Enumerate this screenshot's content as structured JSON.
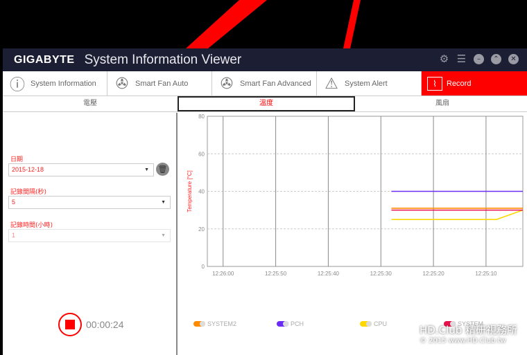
{
  "titlebar": {
    "brand": "GIGABYTE",
    "title": "System Information Viewer",
    "controls": [
      "gear-icon",
      "list-icon",
      "minimize-icon",
      "restore-icon",
      "close-icon"
    ]
  },
  "tabs": [
    {
      "label": "System Information",
      "icon": "info-icon"
    },
    {
      "label": "Smart Fan Auto",
      "icon": "fan-icon"
    },
    {
      "label": "Smart Fan Advanced",
      "icon": "fan-plus-icon"
    },
    {
      "label": "System Alert",
      "icon": "warning-icon"
    },
    {
      "label": "Record",
      "icon": "heartbeat-icon",
      "active": true
    }
  ],
  "subtabs": [
    {
      "label": "電壓"
    },
    {
      "label": "溫度",
      "active": true
    },
    {
      "label": "風扇"
    }
  ],
  "left": {
    "date_label": "日期",
    "date_value": "2015-12-18",
    "interval_label": "記錄間隔(秒)",
    "interval_value": "5",
    "duration_label": "記錄時間(小時)",
    "duration_value": "1",
    "timer": "00:00:24"
  },
  "colors": {
    "accent": "#ff0000",
    "titlebar": "#1c1f33"
  },
  "chart_data": {
    "type": "line",
    "ylabel": "Temperature [°C]",
    "ylim": [
      0,
      80
    ],
    "yticks": [
      "0",
      "20",
      "40",
      "60",
      "80"
    ],
    "xticks": [
      "12:26:00",
      "12:25:50",
      "12:25:40",
      "12:25:30",
      "12:25:20",
      "12:25:10"
    ],
    "x_axis": "time, decreasing left to right",
    "xlim": [
      "12:26:03",
      "12:25:03"
    ],
    "grid": "vertical solid, horizontal dashed",
    "legend_placement": "bottom",
    "series": [
      {
        "name": "SYSTEM2",
        "color": "#ff8c00",
        "x": [
          "12:25:28",
          "12:25:03"
        ],
        "values": [
          31,
          31
        ]
      },
      {
        "name": "PCH",
        "color": "#6a2cf5",
        "x": [
          "12:25:28",
          "12:25:03"
        ],
        "values": [
          40,
          40
        ]
      },
      {
        "name": "CPU",
        "color": "#ffd800",
        "x": [
          "12:25:28",
          "12:25:08",
          "12:25:03"
        ],
        "values": [
          25,
          25,
          30
        ]
      },
      {
        "name": "SYSTEM",
        "color": "#e8104a",
        "x": [
          "12:25:28",
          "12:25:03"
        ],
        "values": [
          30,
          30
        ]
      }
    ]
  },
  "watermark": {
    "line1": "HD.Club 精研視務所",
    "line2": "© 2015  www.HD.Club.tw"
  }
}
